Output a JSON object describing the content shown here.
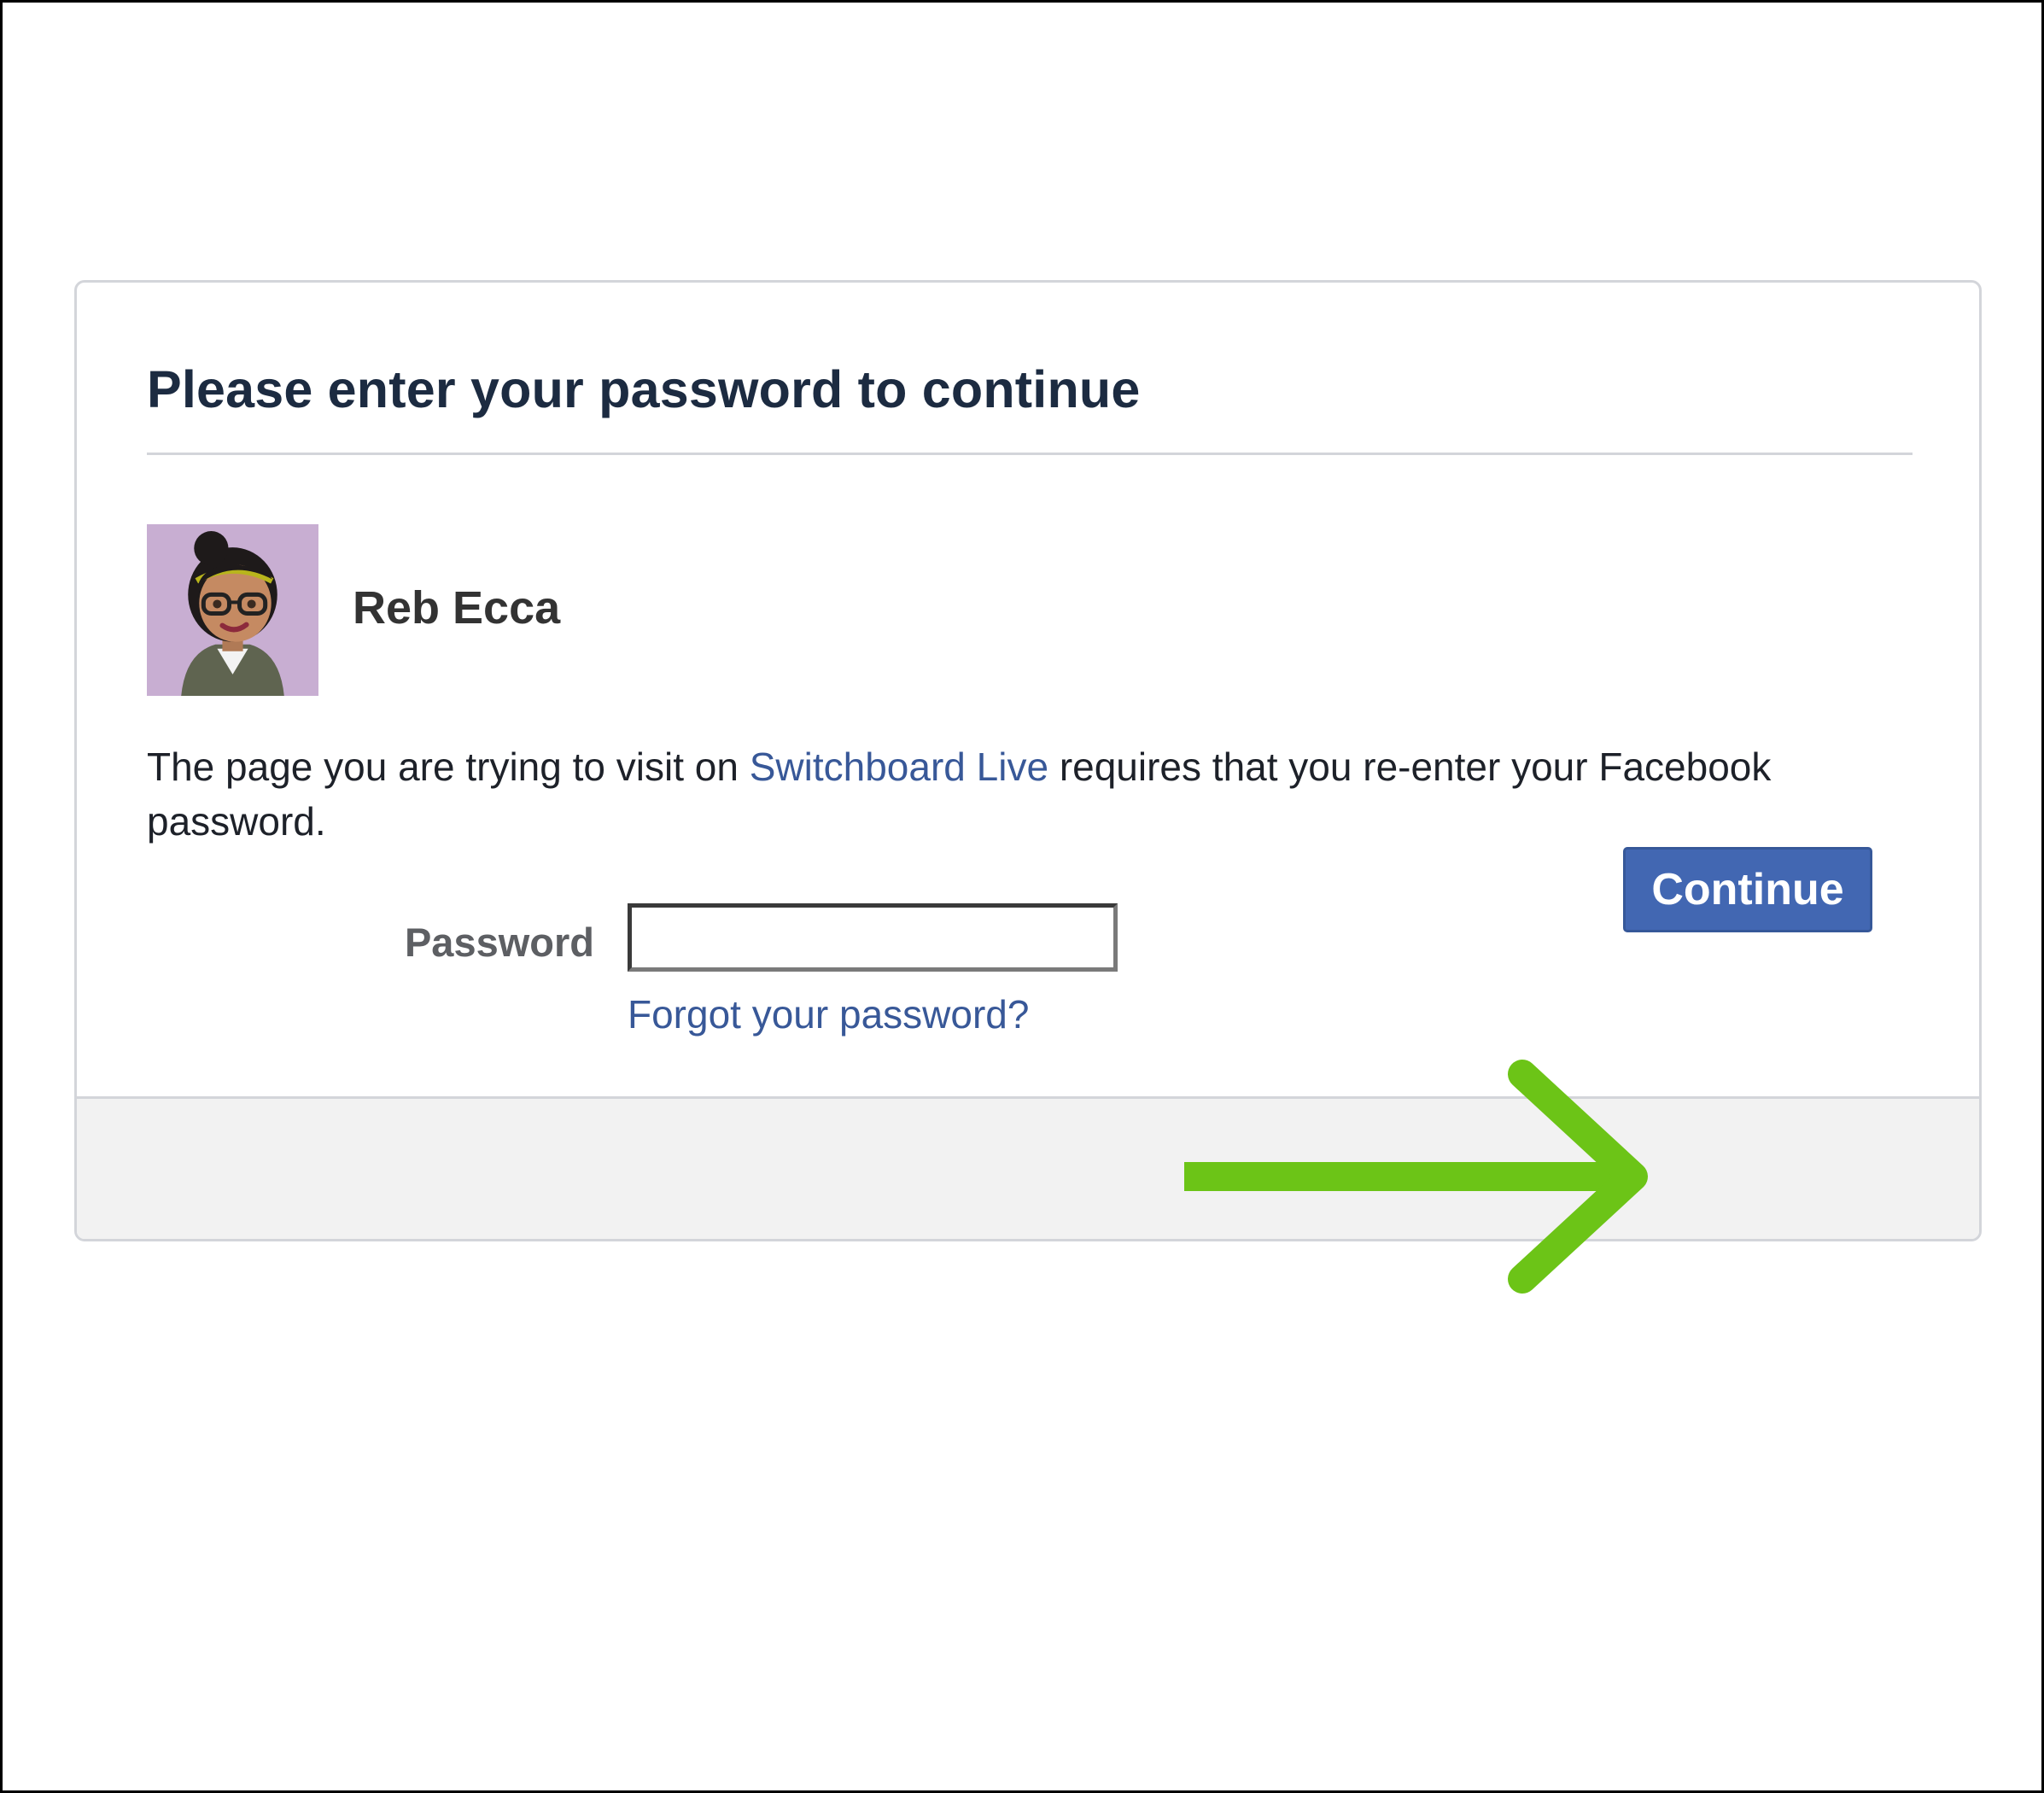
{
  "dialog": {
    "title": "Please enter your password to continue",
    "user": {
      "name": "Reb Ecca",
      "avatar_icon": "bitmoji-avatar-icon"
    },
    "message": {
      "prefix": "The page you are trying to visit on ",
      "app_link": "Switchboard Live",
      "suffix": " requires that you re-enter your Facebook password."
    },
    "password": {
      "label": "Password",
      "value": "",
      "placeholder": ""
    },
    "forgot_link": "Forgot your password?",
    "continue_label": "Continue"
  },
  "annotation": {
    "arrow_icon": "green-arrow-right-icon",
    "arrow_color": "#6cc417"
  },
  "colors": {
    "primary": "#4267b2",
    "link": "#385898",
    "title": "#1c2b41",
    "footer_bg": "#f2f2f2"
  }
}
